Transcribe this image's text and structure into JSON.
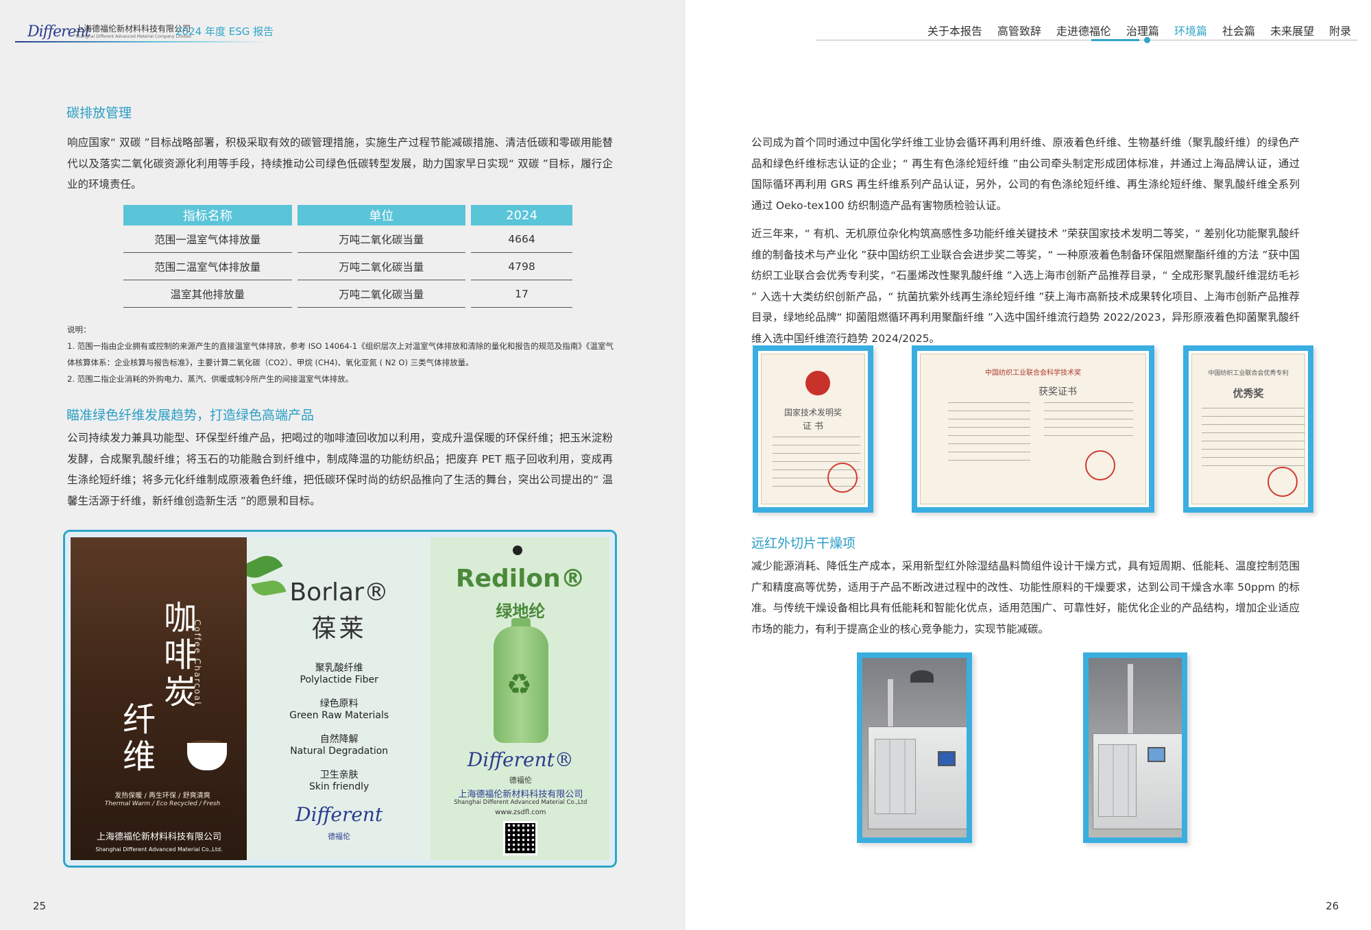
{
  "header": {
    "logo_text": "Different",
    "company_cn": "上海德福伦新材料科技有限公司",
    "company_en": "Shanghai Different Advanced Material Company Limited",
    "report_title": "2024 年度 ESG 报告",
    "nav": [
      "关于本报告",
      "高管致辞",
      "走进德福伦",
      "治理篇",
      "环境篇",
      "社会篇",
      "未来展望",
      "附录"
    ],
    "active_nav": "环境篇",
    "accent_color": "#2ea5c9"
  },
  "left": {
    "section1_title": "碳排放管理",
    "section1_p1": "响应国家“ 双碳 ”目标战略部署，积极采取有效的碳管理措施，实施生产过程节能减碳措施、清洁低碳和零碳用能替代以及落实二氧化碳资源化利用等手段，持续推动公司绿色低碳转型发展，助力国家早日实现“ 双碳 ”目标，履行企业的环境责任。",
    "table": {
      "headers": [
        "指标名称",
        "单位",
        "2024"
      ],
      "rows": [
        [
          "范围一温室气体排放量",
          "万吨二氧化碳当量",
          "4664"
        ],
        [
          "范围二温室气体排放量",
          "万吨二氧化碳当量",
          "4798"
        ],
        [
          "温室其他排放量",
          "万吨二氧化碳当量",
          "17"
        ]
      ]
    },
    "notes": {
      "label": "说明：",
      "n1": "1. 范围一指由企业拥有或控制的来源产生的直接温室气体排放，参考 ISO 14064-1《组织层次上对温室气体排放和清除的量化和报告的规范及指南》《温室气体核算体系：企业核算与报告标准》，主要计算二氧化碳（CO2）、甲烷 (CH4)、氧化亚氮 ( N2 O) 三类气体排放量。",
      "n2": "2. 范围二指企业消耗的外购电力、蒸汽、供暖或制冷所产生的间接温室气体排放。"
    },
    "section2_title": "瞄准绿色纤维发展趋势，打造绿色高端产品",
    "section2_p1": "公司持续发力兼具功能型、环保型纤维产品，把喝过的咖啡渣回收加以利用，变成升温保暖的环保纤维；把玉米淀粉发酵，合成聚乳酸纤维；将玉石的功能融合到纤维中，制成降温的功能纺织品；把废弃 PET 瓶子回收利用，变成再生涤纶短纤维；将多元化纤维制成原液着色纤维，把低碳环保时尚的纺织品推向了生活的舞台，突出公司提出的“ 温馨生活源于纤维，新纤维创造新生活 ”的愿景和目标。",
    "products": {
      "p1": {
        "title_a": "咖啡炭",
        "title_b": "纤维",
        "en": "Coffee Charcoal",
        "sub": "发热保暖 / 再生环保 / 舒爽清爽",
        "sub_en": "Thermal Warm / Eco Recycled / Fresh",
        "company_cn": "上海德福伦新材料科技有限公司",
        "company_en": "Shanghai Different Advanced Material Co.,Ltd."
      },
      "p2": {
        "brand": "Borlar®",
        "brand_cn": "葆莱",
        "l1": "聚乳酸纤维",
        "l2": "Polylactide Fiber",
        "l3": "绿色原料",
        "l4": "Green Raw Materials",
        "l5": "自然降解",
        "l6": "Natural Degradation",
        "l7": "卫生亲肤",
        "l8": "Skin friendly",
        "logo": "Different",
        "logo_cn": "德福伦"
      },
      "p3": {
        "brand": "Redilon®",
        "brand_cn": "绿地纶",
        "recycle": "♻",
        "logo": "Different®",
        "logo_cn": "德福伦",
        "company_cn": "上海德福伦新材料科技有限公司",
        "company_en": "Shanghai Different Advanced Material Co.,Ltd",
        "url": "www.zsdfl.com"
      }
    },
    "page_number": "25"
  },
  "right": {
    "p1": "公司成为首个同时通过中国化学纤维工业协会循环再利用纤维、原液着色纤维、生物基纤维（聚乳酸纤维）的绿色产品和绿色纤维标志认证的企业；“ 再生有色涤纶短纤维 ”由公司牵头制定形成团体标准，并通过上海品牌认证，通过国际循环再利用 GRS 再生纤维系列产品认证，另外，公司的有色涤纶短纤维、再生涤纶短纤维、聚乳酸纤维全系列通过 Oeko-tex100 纺织制造产品有害物质检验认证。",
    "p2": "近三年来，“ 有机、无机原位杂化构筑高感性多功能纤维关键技术 ”荣获国家技术发明二等奖，“ 差别化功能聚乳酸纤维的制备技术与产业化 ”获中国纺织工业联合会进步奖二等奖，“ 一种原液着色制备环保阻燃聚酯纤维的方法 ”获中国纺织工业联合会优秀专利奖，“石墨烯改性聚乳酸纤维 ”入选上海市创新产品推荐目录，“ 全成形聚乳酸纤维混纺毛衫 ” 入选十大类纺织创新产品，“ 抗菌抗紫外线再生涤纶短纤维 ”获上海市高新技术成果转化项目、上海市创新产品推荐目录，绿地纶品牌“ 抑菌阻燃循环再利用聚酯纤维 ”入选中国纤维流行趋势 2022/2023，异形原液着色抑菌聚乳酸纤维入选中国纤维流行趋势 2024/2025。",
    "certs": {
      "c1_title": "国家技术发明奖",
      "c1_sub": "证 书",
      "c2_head": "中国纺织工业联合会科学技术奖",
      "c2_title": "获奖证书",
      "c3_head": "中国纺织工业联合会优秀专利",
      "c3_title": "优秀奖"
    },
    "section_title": "远红外切片干燥项",
    "p3": "减少能源消耗、降低生产成本，采用新型红外除湿结晶料筒组件设计干燥方式，具有短周期、低能耗、温度控制范围广和精度高等优势，适用于产品不断改进过程中的改性、功能性原料的干燥要求，达到公司干燥含水率 50ppm 的标准。与传统干燥设备相比具有低能耗和智能化优点，适用范围广、可靠性好，能优化企业的产品结构，增加企业适应市场的能力，有利于提高企业的核心竞争能力，实现节能减碳。",
    "page_number": "26"
  }
}
